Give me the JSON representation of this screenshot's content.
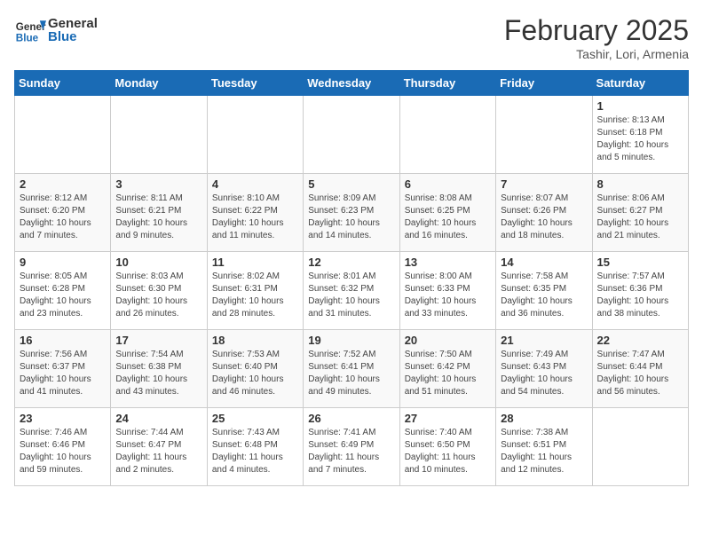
{
  "header": {
    "logo_general": "General",
    "logo_blue": "Blue",
    "month_year": "February 2025",
    "location": "Tashir, Lori, Armenia"
  },
  "weekdays": [
    "Sunday",
    "Monday",
    "Tuesday",
    "Wednesday",
    "Thursday",
    "Friday",
    "Saturday"
  ],
  "weeks": [
    [
      {
        "day": "",
        "info": ""
      },
      {
        "day": "",
        "info": ""
      },
      {
        "day": "",
        "info": ""
      },
      {
        "day": "",
        "info": ""
      },
      {
        "day": "",
        "info": ""
      },
      {
        "day": "",
        "info": ""
      },
      {
        "day": "1",
        "info": "Sunrise: 8:13 AM\nSunset: 6:18 PM\nDaylight: 10 hours\nand 5 minutes."
      }
    ],
    [
      {
        "day": "2",
        "info": "Sunrise: 8:12 AM\nSunset: 6:20 PM\nDaylight: 10 hours\nand 7 minutes."
      },
      {
        "day": "3",
        "info": "Sunrise: 8:11 AM\nSunset: 6:21 PM\nDaylight: 10 hours\nand 9 minutes."
      },
      {
        "day": "4",
        "info": "Sunrise: 8:10 AM\nSunset: 6:22 PM\nDaylight: 10 hours\nand 11 minutes."
      },
      {
        "day": "5",
        "info": "Sunrise: 8:09 AM\nSunset: 6:23 PM\nDaylight: 10 hours\nand 14 minutes."
      },
      {
        "day": "6",
        "info": "Sunrise: 8:08 AM\nSunset: 6:25 PM\nDaylight: 10 hours\nand 16 minutes."
      },
      {
        "day": "7",
        "info": "Sunrise: 8:07 AM\nSunset: 6:26 PM\nDaylight: 10 hours\nand 18 minutes."
      },
      {
        "day": "8",
        "info": "Sunrise: 8:06 AM\nSunset: 6:27 PM\nDaylight: 10 hours\nand 21 minutes."
      }
    ],
    [
      {
        "day": "9",
        "info": "Sunrise: 8:05 AM\nSunset: 6:28 PM\nDaylight: 10 hours\nand 23 minutes."
      },
      {
        "day": "10",
        "info": "Sunrise: 8:03 AM\nSunset: 6:30 PM\nDaylight: 10 hours\nand 26 minutes."
      },
      {
        "day": "11",
        "info": "Sunrise: 8:02 AM\nSunset: 6:31 PM\nDaylight: 10 hours\nand 28 minutes."
      },
      {
        "day": "12",
        "info": "Sunrise: 8:01 AM\nSunset: 6:32 PM\nDaylight: 10 hours\nand 31 minutes."
      },
      {
        "day": "13",
        "info": "Sunrise: 8:00 AM\nSunset: 6:33 PM\nDaylight: 10 hours\nand 33 minutes."
      },
      {
        "day": "14",
        "info": "Sunrise: 7:58 AM\nSunset: 6:35 PM\nDaylight: 10 hours\nand 36 minutes."
      },
      {
        "day": "15",
        "info": "Sunrise: 7:57 AM\nSunset: 6:36 PM\nDaylight: 10 hours\nand 38 minutes."
      }
    ],
    [
      {
        "day": "16",
        "info": "Sunrise: 7:56 AM\nSunset: 6:37 PM\nDaylight: 10 hours\nand 41 minutes."
      },
      {
        "day": "17",
        "info": "Sunrise: 7:54 AM\nSunset: 6:38 PM\nDaylight: 10 hours\nand 43 minutes."
      },
      {
        "day": "18",
        "info": "Sunrise: 7:53 AM\nSunset: 6:40 PM\nDaylight: 10 hours\nand 46 minutes."
      },
      {
        "day": "19",
        "info": "Sunrise: 7:52 AM\nSunset: 6:41 PM\nDaylight: 10 hours\nand 49 minutes."
      },
      {
        "day": "20",
        "info": "Sunrise: 7:50 AM\nSunset: 6:42 PM\nDaylight: 10 hours\nand 51 minutes."
      },
      {
        "day": "21",
        "info": "Sunrise: 7:49 AM\nSunset: 6:43 PM\nDaylight: 10 hours\nand 54 minutes."
      },
      {
        "day": "22",
        "info": "Sunrise: 7:47 AM\nSunset: 6:44 PM\nDaylight: 10 hours\nand 56 minutes."
      }
    ],
    [
      {
        "day": "23",
        "info": "Sunrise: 7:46 AM\nSunset: 6:46 PM\nDaylight: 10 hours\nand 59 minutes."
      },
      {
        "day": "24",
        "info": "Sunrise: 7:44 AM\nSunset: 6:47 PM\nDaylight: 11 hours\nand 2 minutes."
      },
      {
        "day": "25",
        "info": "Sunrise: 7:43 AM\nSunset: 6:48 PM\nDaylight: 11 hours\nand 4 minutes."
      },
      {
        "day": "26",
        "info": "Sunrise: 7:41 AM\nSunset: 6:49 PM\nDaylight: 11 hours\nand 7 minutes."
      },
      {
        "day": "27",
        "info": "Sunrise: 7:40 AM\nSunset: 6:50 PM\nDaylight: 11 hours\nand 10 minutes."
      },
      {
        "day": "28",
        "info": "Sunrise: 7:38 AM\nSunset: 6:51 PM\nDaylight: 11 hours\nand 12 minutes."
      },
      {
        "day": "",
        "info": ""
      }
    ]
  ]
}
